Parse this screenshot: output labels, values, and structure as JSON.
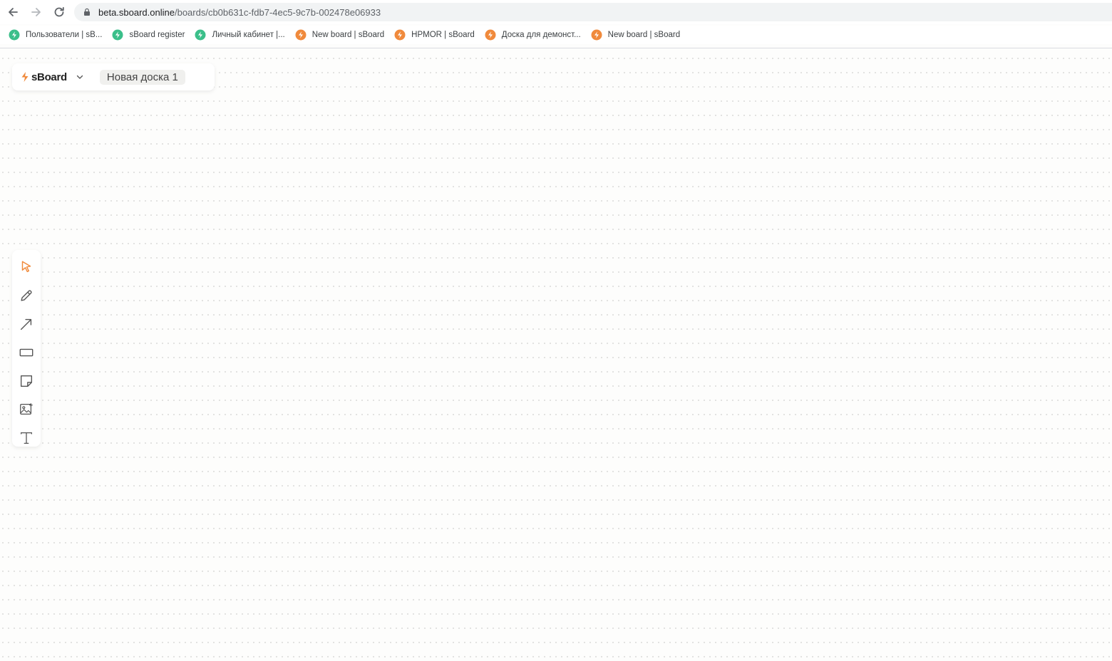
{
  "browser": {
    "url_host": "beta.sboard.online",
    "url_path": "/boards/cb0b631c-fdb7-4ec5-9c7b-002478e06933",
    "bookmarks": [
      {
        "label": "Пользователи | sB...",
        "icon": "green-favicon"
      },
      {
        "label": "sBoard register",
        "icon": "green-favicon"
      },
      {
        "label": "Личный кабинет |...",
        "icon": "green-favicon"
      },
      {
        "label": "New board | sBoard",
        "icon": "orange-favicon"
      },
      {
        "label": "HPMOR | sBoard",
        "icon": "orange-favicon"
      },
      {
        "label": "Доска для демонст...",
        "icon": "orange-favicon"
      },
      {
        "label": "New board | sBoard",
        "icon": "orange-favicon"
      }
    ]
  },
  "app": {
    "brand": "sBoard",
    "board_title": "Новая доска 1",
    "accent_color": "#f08a3c"
  },
  "toolbar": {
    "tools": [
      {
        "name": "select",
        "icon": "cursor-icon",
        "active": true
      },
      {
        "name": "pen",
        "icon": "pencil-icon",
        "active": false
      },
      {
        "name": "arrow",
        "icon": "arrow-icon",
        "active": false
      },
      {
        "name": "shape",
        "icon": "rectangle-icon",
        "active": false
      },
      {
        "name": "sticker",
        "icon": "sticky-note-icon",
        "active": false
      },
      {
        "name": "image",
        "icon": "image-icon",
        "active": false
      },
      {
        "name": "text",
        "icon": "text-icon",
        "active": false
      }
    ]
  }
}
